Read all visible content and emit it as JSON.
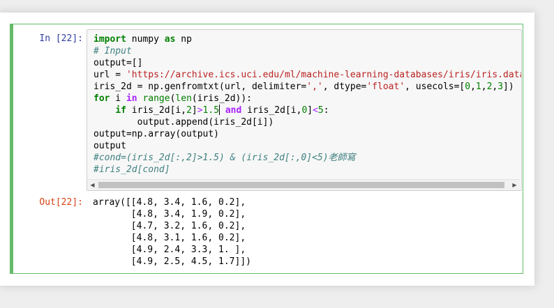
{
  "cell": {
    "in_prompt": "In [22]:",
    "out_prompt": "Out[22]:",
    "code": {
      "l1_kw": "import",
      "l1_mod": " numpy ",
      "l1_as": "as",
      "l1_alias": " np",
      "l2_comment": "# Input",
      "l3": "output=[]",
      "l4_pre": "url = ",
      "l4_str": "'https://archive.ics.uci.edu/ml/machine-learning-databases/iris/iris.data'",
      "l5_pre": "iris_2d = np.genfromtxt(url, delimiter=",
      "l5_delim": "','",
      "l5_mid": ", dtype=",
      "l5_dtype": "'float'",
      "l5_mid2": ", usecols=[",
      "l5_n0": "0",
      "l5_c1": ",",
      "l5_n1": "1",
      "l5_c2": ",",
      "l5_n2": "2",
      "l5_c3": ",",
      "l5_n3": "3",
      "l5_end": "])",
      "l6_for": "for",
      "l6_i": " i ",
      "l6_in": "in",
      "l6_sp": " ",
      "l6_range": "range",
      "l6_p": "(",
      "l6_len": "len",
      "l6_end": "(iris_2d)):",
      "l7_indent": "    ",
      "l7_if": "if",
      "l7_a": " iris_2d[i,",
      "l7_n2": "2",
      "l7_b": "]",
      "l7_gt": ">",
      "l7_n15": "1.5",
      "l7_sp": " ",
      "l7_and": "and",
      "l7_c": " iris_2d[i,",
      "l7_n0": "0",
      "l7_d": "]",
      "l7_lt": "<",
      "l7_n5": "5",
      "l7_e": ":",
      "l8": "        output.append(iris_2d[i])",
      "l9": "output=np.array(output)",
      "l10": "output",
      "l11_comment": "#cond=(iris_2d[:,2]>1.5) & (iris_2d[:,0]<5)老師寫",
      "l12_comment": "#iris_2d[cond]"
    },
    "output_lines": [
      "array([[4.8, 3.4, 1.6, 0.2],",
      "       [4.8, 3.4, 1.9, 0.2],",
      "       [4.7, 3.2, 1.6, 0.2],",
      "       [4.8, 3.1, 1.6, 0.2],",
      "       [4.9, 2.4, 3.3, 1. ],",
      "       [4.9, 2.5, 4.5, 1.7]])"
    ],
    "colors": {
      "cell_border": "#66bb6a",
      "in_prompt": "#303f9f",
      "out_prompt": "#d84315"
    },
    "icons": {
      "scroll_left": "◀",
      "scroll_right": "▶"
    }
  }
}
